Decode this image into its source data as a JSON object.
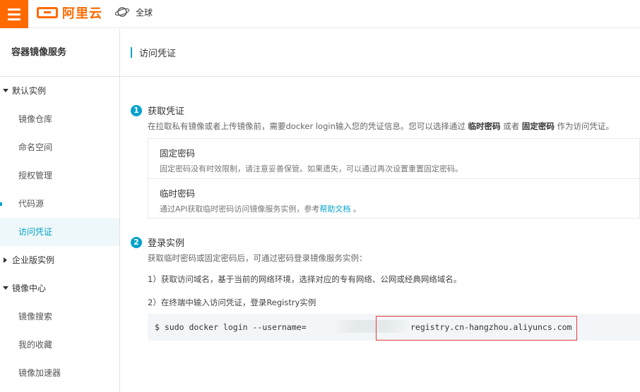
{
  "topbar": {
    "brand": "阿里云",
    "region": "全球"
  },
  "sidebar": {
    "title": "容器镜像服务",
    "groups": [
      {
        "label": "默认实例",
        "expanded": true,
        "items": [
          "镜像仓库",
          "命名空间",
          "授权管理",
          "代码源",
          "访问凭证"
        ]
      },
      {
        "label": "企业版实例",
        "expanded": false,
        "items": []
      },
      {
        "label": "镜像中心",
        "expanded": true,
        "items": [
          "镜像搜索",
          "我的收藏",
          "镜像加速器"
        ]
      }
    ],
    "active_item": "访问凭证"
  },
  "main": {
    "title": "访问凭证",
    "step1": {
      "num": "1",
      "title": "获取凭证",
      "desc_prefix": "在拉取私有镜像或者上传镜像前，需要docker login输入您的凭证信息。您可以选择通过",
      "desc_opt1": "临时密码",
      "desc_mid": "或者",
      "desc_opt2": "固定密码",
      "desc_suffix": "作为访问凭证。",
      "cards": [
        {
          "title": "固定密码",
          "desc": "固定密码没有时效限制，请注意妥善保管。如果遗失，可以通过再次设置重置固定密码。"
        },
        {
          "title": "临时密码",
          "desc": "通过API获取临时密码访问镜像服务实例，参考",
          "link": "帮助文档",
          "desc_end": "。"
        }
      ]
    },
    "step2": {
      "num": "2",
      "title": "登录实例",
      "desc": "获取临时密码或固定密码后，可通过密码登录镜像服务实例：",
      "line1": "1）获取访问域名，基于当前的网络环境，选择对应的专有网络、公网或经典网络域名。",
      "line2": "2）在终端中输入访问凭证，登录Registry实例",
      "command_prefix": "$ sudo docker login --username=",
      "command_registry": "registry.cn-hangzhou.aliyuncs.com"
    }
  },
  "colors": {
    "brand": "#ff6a00",
    "accent": "#00a2ca",
    "highlight": "#e23a3a"
  }
}
